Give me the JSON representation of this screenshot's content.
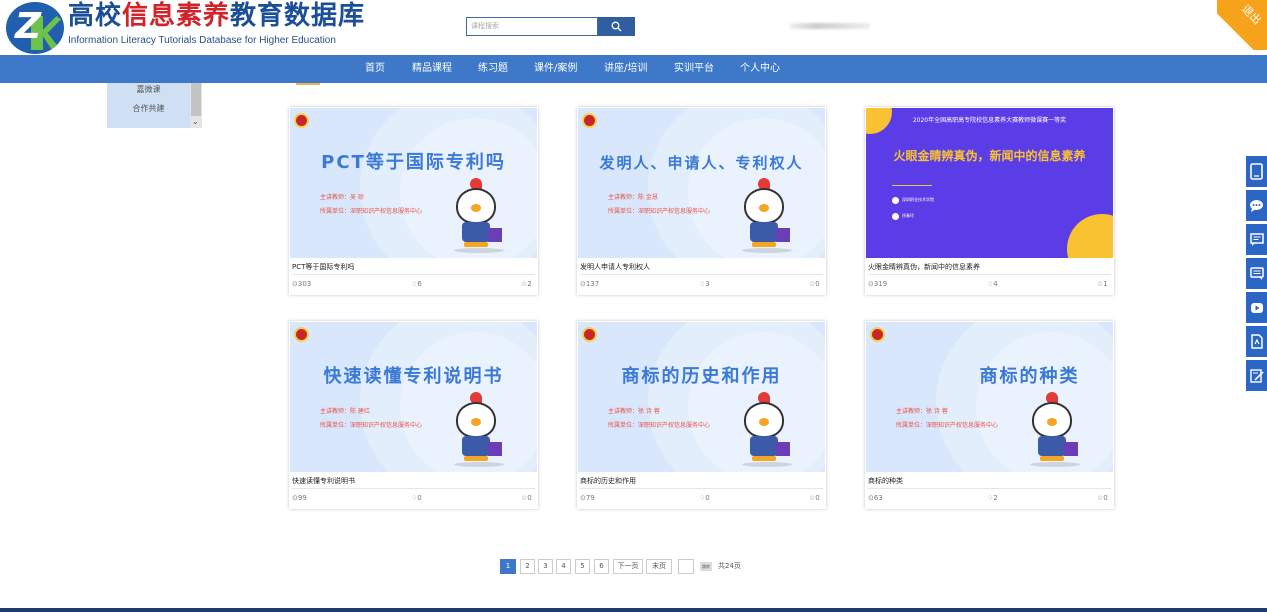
{
  "header": {
    "title_part1": "高校",
    "title_part2": "信息素养",
    "title_part3": "教育数据库",
    "subtitle": "Information Literacy Tutorials Database for Higher Education",
    "search_placeholder": "课程搜索",
    "logout_label": "退出"
  },
  "nav": {
    "items": [
      "首页",
      "精品课程",
      "练习题",
      "课件/案例",
      "讲座/培训",
      "实训平台",
      "个人中心"
    ]
  },
  "left_panel": {
    "items": [
      "嘉微课",
      "合作共建"
    ]
  },
  "courses": [
    {
      "name": "PCT等于国际专利吗",
      "slide_title": "PCT等于国际专利吗",
      "teacher": "主讲教师：吴 琼",
      "unit": "所属单位：深职知识产权信息服务中心",
      "views": "303",
      "likes": "6",
      "favorites": "2"
    },
    {
      "name": "发明人申请人专利权人",
      "slide_title": "发明人、申请人、专利权人",
      "teacher": "主讲教师：陈 金慧",
      "unit": "所属单位：深职知识产权信息服务中心",
      "views": "137",
      "likes": "3",
      "favorites": "0"
    },
    {
      "name": "火眼金睛辨真伪，新闻中的信息素养",
      "slide_top": "2020年全国高职高专院校信息素养大赛教师微课赛一等奖",
      "slide_title": "火眼金睛辨真伪，新闻中的信息素养",
      "school": "深圳职业技术学院",
      "author": "徐春玲",
      "views": "319",
      "likes": "4",
      "favorites": "1"
    },
    {
      "name": "快速读懂专利说明书",
      "slide_title": "快速读懂专利说明书",
      "teacher": "主讲教师：陈 建红",
      "unit": "所属单位：深职知识产权信息服务中心",
      "views": "99",
      "likes": "0",
      "favorites": "0"
    },
    {
      "name": "商标的历史和作用",
      "slide_title": "商标的历史和作用",
      "teacher": "主讲教师：徐 诗 蓉",
      "unit": "所属单位：深职知识产权信息服务中心",
      "views": "79",
      "likes": "0",
      "favorites": "0"
    },
    {
      "name": "商标的种类",
      "slide_title": "商标的种类",
      "teacher": "主讲教师：徐 诗 蓉",
      "unit": "所属单位：深职知识产权信息服务中心",
      "views": "63",
      "likes": "2",
      "favorites": "0"
    }
  ],
  "pagination": {
    "pages": [
      "1",
      "2",
      "3",
      "4",
      "5",
      "6"
    ],
    "next": "下一页",
    "last": "末页",
    "go": "跳转",
    "total": "共24页"
  },
  "side_toolbar": {
    "icons": [
      "tablet-icon",
      "chat-icon",
      "message-icon",
      "comment-icon",
      "video-icon",
      "document-icon",
      "edit-icon"
    ]
  },
  "colors": {
    "nav_blue": "#3e78c8",
    "logo_blue": "#1a4e96",
    "logo_red": "#d0232a",
    "logout_orange": "#f7a21b",
    "slide_purple": "#5b3de8"
  }
}
